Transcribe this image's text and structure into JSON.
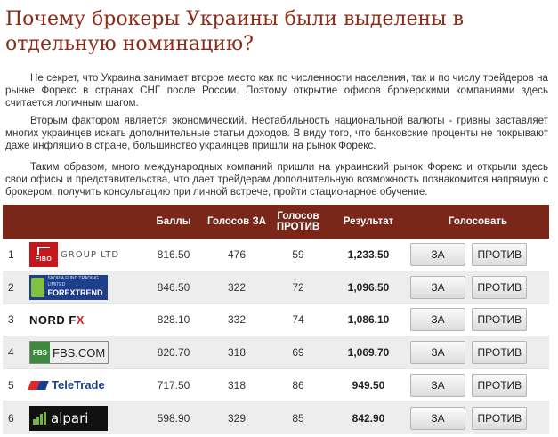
{
  "article": {
    "title": "Почему брокеры Украины были выделены в отдельную номинацию?",
    "paragraphs": [
      "Не секрет, что Украина занимает второе место как по численности населения, так и по числу трейдеров на рынке Форекс в странах СНГ после России. Поэтому открытие офисов брокерскими компаниями здесь считается логичным шагом.",
      "Вторым фактором является экономический. Нестабильность национальной валюты - гривны заставляет многих украинцев искать дополнительные статьи доходов. В виду того, что банковские проценты не покрывают даже инфляцию в стране, большинство украинцев пришли на рынок Форекс.",
      "Таким образом, много международных компаний пришли на украинский рынок Форекс и открыли здесь свои офисы и представительства, что дает трейдерам дополнительную возможность познакомится напрямую с брокером, получить консультацию при личной встрече, пройти стационарное обучение."
    ]
  },
  "table": {
    "headers": {
      "rank": "",
      "broker": "",
      "score": "Баллы",
      "votes_for": "Голосов ЗА",
      "votes_against": "Голосов ПРОТИВ",
      "result": "Результат",
      "vote": "Голосовать"
    },
    "button_for": "ЗА",
    "button_against": "ПРОТИВ",
    "rows": [
      {
        "rank": "1",
        "broker": "FIBO GROUP LTD",
        "logo_lines": [
          "FIBO",
          "GROUP LTD"
        ],
        "score": "816.50",
        "votes_for": "476",
        "votes_against": "59",
        "result": "1,233.50"
      },
      {
        "rank": "2",
        "broker": "FOREXTREND",
        "logo_lines": [
          "SKOPIA FUND TRADING LIMITED",
          "FOREXTREND"
        ],
        "score": "846.50",
        "votes_for": "322",
        "votes_against": "72",
        "result": "1,096.50"
      },
      {
        "rank": "3",
        "broker": "NORD FX",
        "logo_lines": [
          "NORD F",
          "X"
        ],
        "score": "828.10",
        "votes_for": "332",
        "votes_against": "74",
        "result": "1,086.10"
      },
      {
        "rank": "4",
        "broker": "FBS.COM",
        "logo_lines": [
          "FBS",
          "FBS.COM"
        ],
        "score": "820.70",
        "votes_for": "318",
        "votes_against": "69",
        "result": "1,069.70"
      },
      {
        "rank": "5",
        "broker": "TeleTrade",
        "logo_lines": [
          "TeleTrade"
        ],
        "score": "717.50",
        "votes_for": "318",
        "votes_against": "86",
        "result": "949.50"
      },
      {
        "rank": "6",
        "broker": "alpari",
        "logo_lines": [
          "alpari"
        ],
        "score": "598.90",
        "votes_for": "329",
        "votes_against": "85",
        "result": "842.90"
      }
    ]
  },
  "colors": {
    "title": "#8b2b17",
    "header_bg": "#7a2618",
    "row_alt_bg": "#ededed"
  }
}
